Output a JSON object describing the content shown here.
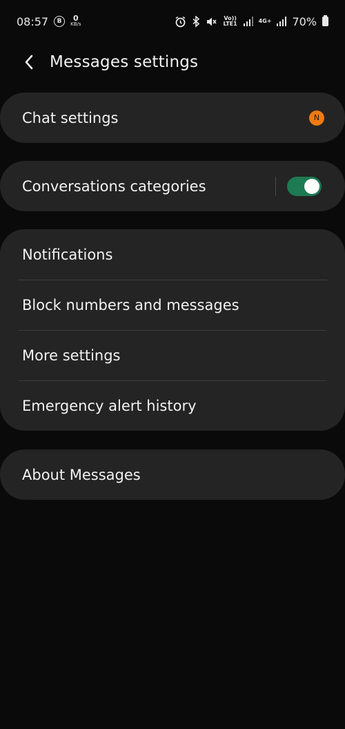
{
  "status_bar": {
    "time": "08:57",
    "b_icon_letter": "B",
    "net_speed_value": "0",
    "net_speed_unit": "KB/s",
    "volte_label": "Vo)) LTE1",
    "network_4g_label": "4G+",
    "battery_percent": "70%"
  },
  "header": {
    "title": "Messages settings"
  },
  "card_chat": {
    "label": "Chat settings",
    "badge": "N",
    "badge_color": "#f07a12"
  },
  "card_categories": {
    "label": "Conversations categories",
    "toggle_on": true,
    "toggle_color": "#1d7a52"
  },
  "card_group": {
    "items": [
      {
        "label": "Notifications"
      },
      {
        "label": "Block numbers and messages"
      },
      {
        "label": "More settings"
      },
      {
        "label": "Emergency alert history"
      }
    ]
  },
  "card_about": {
    "label": "About Messages"
  }
}
